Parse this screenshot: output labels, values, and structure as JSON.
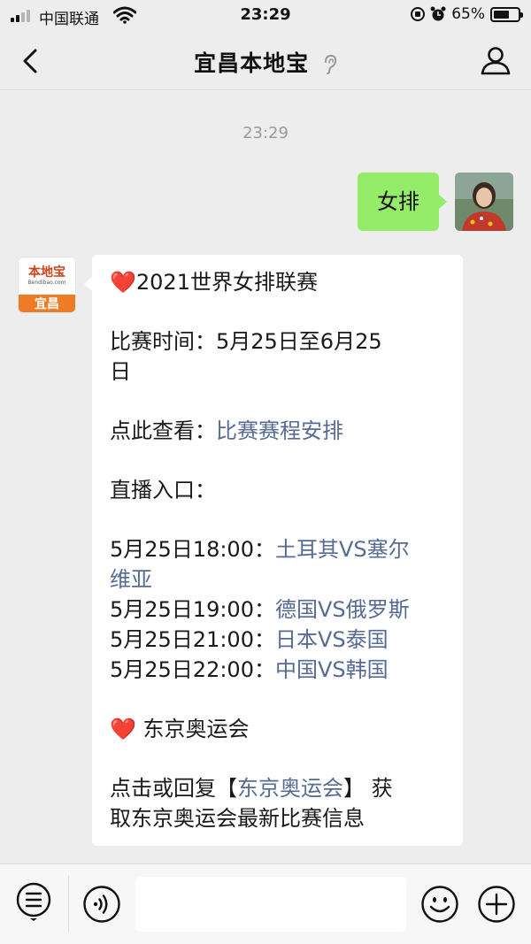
{
  "status_bar": {
    "carrier": "中国联通",
    "time": "23:29",
    "battery_percent": "65%",
    "battery_level": 0.65,
    "signal_bars": 2,
    "icons": [
      "signal-icon",
      "wifi-icon",
      "orientation-lock-icon",
      "alarm-icon",
      "battery-icon"
    ]
  },
  "nav": {
    "title": "宜昌本地宝",
    "icons": [
      "back-chevron-icon",
      "ear-icon",
      "profile-icon"
    ]
  },
  "chat": {
    "timestamp": "23:29",
    "user_message": "女排",
    "bot_avatar": {
      "brand": "本地宝",
      "sub": "Bendibao.com",
      "city": "宜昌"
    },
    "reply": {
      "heart": "❤️",
      "title": "2021世界女排联赛",
      "time_line_1": "比赛时间：5月25日至6月25",
      "time_line_2": "日",
      "view_prefix": "点此查看：",
      "view_link": "比赛赛程安排",
      "live_label": "直播入口：",
      "matches": [
        {
          "time": "5月25日18:00：",
          "teams_line_1": "土耳其VS塞尔",
          "teams_line_2": "维亚"
        },
        {
          "time": "5月25日19:00：",
          "teams_line_1": "德国VS俄罗斯"
        },
        {
          "time": "5月25日21:00：",
          "teams_line_1": "日本VS泰国"
        },
        {
          "time": "5月25日22:00：",
          "teams_line_1": "中国VS韩国"
        }
      ],
      "olympics_title": " 东京奥运会",
      "reply_prefix": "点击或回复【",
      "reply_link": "东京奥运会",
      "reply_suffix": "】 获",
      "reply_line_2": "取东京奥运会最新比赛信息"
    }
  },
  "input_bar": {
    "placeholder": "",
    "icons": [
      "menu-icon",
      "voice-icon",
      "emoji-icon",
      "plus-icon"
    ]
  },
  "colors": {
    "background": "#ededed",
    "my_bubble": "#95ec69",
    "link": "#576b95",
    "heart": "#e0203a"
  }
}
